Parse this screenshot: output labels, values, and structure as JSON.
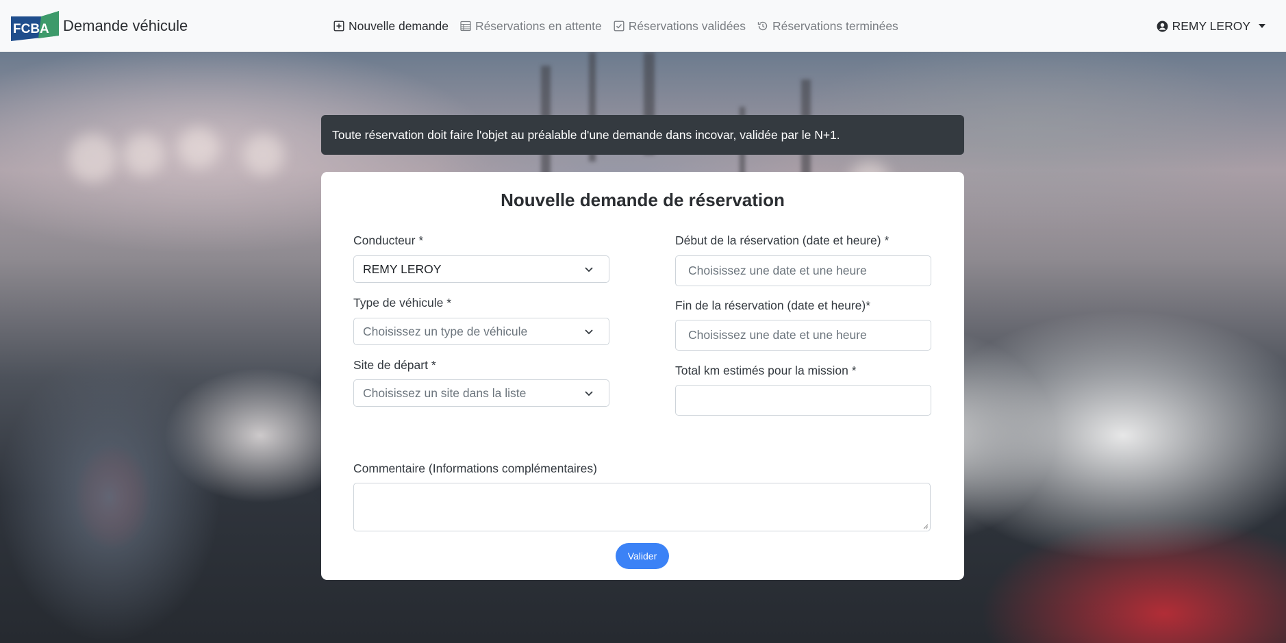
{
  "navbar": {
    "logo_text": "FCBA",
    "brand_title": "Demande véhicule",
    "links": [
      {
        "label": "Nouvelle demande",
        "icon": "plus-square-icon",
        "active": true
      },
      {
        "label": "Réservations en attente",
        "icon": "table-icon",
        "active": false
      },
      {
        "label": "Réservations validées",
        "icon": "check-square-icon",
        "active": false
      },
      {
        "label": "Réservations terminées",
        "icon": "history-icon",
        "active": false
      }
    ],
    "user_name": "REMY LEROY"
  },
  "alert": {
    "text": "Toute réservation doit faire l'objet au préalable d'une demande dans incovar, validée par le N+1."
  },
  "form": {
    "title": "Nouvelle demande de réservation",
    "conducteur": {
      "label": "Conducteur *",
      "value": "REMY LEROY"
    },
    "type_vehicule": {
      "label": "Type de véhicule *",
      "placeholder": "Choisissez un type de véhicule"
    },
    "site_depart": {
      "label": "Site de départ *",
      "placeholder": "Choisissez un site dans la liste"
    },
    "debut": {
      "label": "Début de la réservation (date et heure) *",
      "placeholder": "Choisissez une date et une heure"
    },
    "fin": {
      "label": "Fin de la réservation (date et heure)*",
      "placeholder": "Choisissez une date et une heure"
    },
    "total_km": {
      "label": "Total km estimés pour la mission *",
      "value": ""
    },
    "commentaire": {
      "label": "Commentaire (Informations complémentaires)",
      "value": ""
    },
    "submit_label": "Valider"
  },
  "colors": {
    "navbar_bg": "#f8f9fa",
    "alert_bg": "#343a40",
    "primary": "#3b82f6",
    "logo_blue": "#1f4e8c",
    "logo_green": "#3d9a6a"
  }
}
